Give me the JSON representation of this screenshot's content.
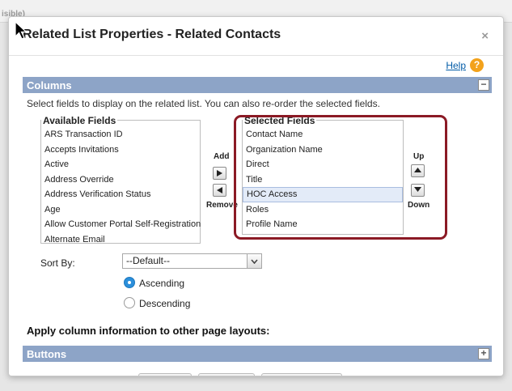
{
  "background": {
    "partial_text": "isible)"
  },
  "dialog": {
    "title": "Related List Properties - Related Contacts",
    "close_label": "×",
    "help_label": "Help",
    "help_icon_glyph": "?"
  },
  "columns": {
    "section_title": "Columns",
    "toggle_glyph": "−",
    "description": "Select fields to display on the related list. You can also re-order the selected fields.",
    "available_fields": {
      "legend": "Available Fields",
      "items": [
        "ARS Transaction ID",
        "Accepts Invitations",
        "Active",
        "Address Override",
        "Address Verification Status",
        "Age",
        "Allow Customer Portal Self-Registration",
        "Alternate Email"
      ]
    },
    "selected_fields": {
      "legend": "Selected Fields",
      "items": [
        "Contact Name",
        "Organization Name",
        "Direct",
        "Title",
        "HOC Access",
        "Roles",
        "Profile Name"
      ],
      "selected_item": "HOC Access"
    },
    "add_label": "Add",
    "remove_label": "Remove",
    "up_label": "Up",
    "down_label": "Down",
    "sort_by_label": "Sort By:",
    "sort_by_value": "--Default--",
    "ascending_label": "Ascending",
    "descending_label": "Descending",
    "sort_order": "Ascending"
  },
  "apply_heading": "Apply column information to other page layouts:",
  "buttons_section": {
    "section_title": "Buttons",
    "toggle_glyph": "+"
  },
  "colors": {
    "section_bar": "#8da4c7",
    "highlight": "#8b1a25",
    "link": "#015ba7",
    "help_icon": "#f3a21b",
    "radio_on": "#2b8fdb"
  }
}
